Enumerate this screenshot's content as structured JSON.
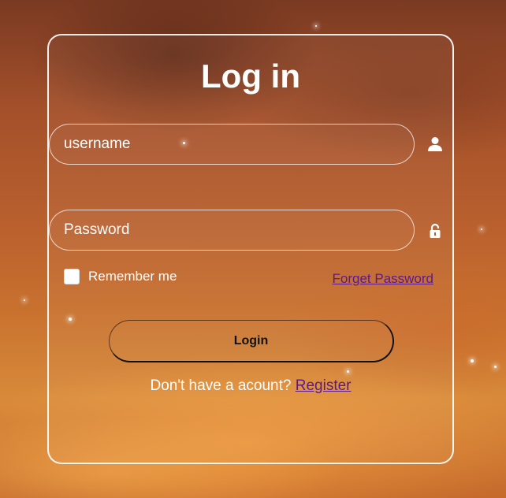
{
  "form": {
    "title": "Log in",
    "username": {
      "placeholder": "username",
      "value": ""
    },
    "password": {
      "placeholder": "Password",
      "value": ""
    },
    "remember_label": "Remember me",
    "remember_checked": false,
    "forgot_label": "Forget Password",
    "login_label": "Login",
    "register_prompt": "Don't have a acount?",
    "register_label": "Register"
  },
  "icons": {
    "username": "user-icon",
    "password": "lock-icon"
  },
  "colors": {
    "link": "#5b1a8c",
    "text": "#ffffff",
    "button_text": "#111111"
  }
}
